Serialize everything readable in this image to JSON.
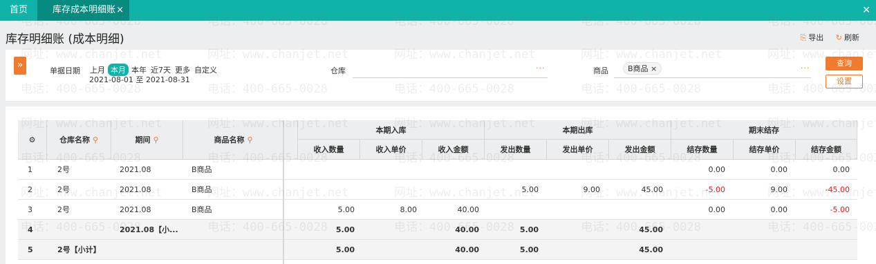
{
  "tabs": {
    "home": "首页",
    "active": "库存成本明细账",
    "active_close": "×",
    "window_close": "✕"
  },
  "header": {
    "title": "库存明细账 (成本明细)",
    "export_label": "导出",
    "refresh_label": "刷新",
    "export_icon": "export-icon",
    "refresh_icon": "refresh-icon"
  },
  "filter": {
    "expand_glyph": "»",
    "date_label": "单据日期",
    "periods": [
      "上月",
      "本月",
      "本年",
      "近7天",
      "更多",
      "自定义"
    ],
    "selected_period": "本月",
    "date_from": "2021-08-01",
    "date_sep": "至",
    "date_to": "2021-08-31",
    "warehouse_label": "仓库",
    "warehouse_value": "",
    "more_dots": "···",
    "product_label": "商品",
    "product_chip": "B商品",
    "chip_close": "×",
    "query_button": "查询",
    "settings_button": "设置"
  },
  "watermark": {
    "phone": "电话：400-665-0028",
    "site": "网址：www.chanjet.net"
  },
  "table": {
    "settings_icon": "gear-icon",
    "pin_glyph": "⚲",
    "headers": {
      "warehouse": "仓库名称",
      "period": "期间",
      "product": "商品名称",
      "group_in": "本期入库",
      "group_out": "本期出库",
      "group_end": "期末结存",
      "in_qty": "收入数量",
      "in_price": "收入单价",
      "in_amount": "收入金额",
      "out_qty": "发出数量",
      "out_price": "发出单价",
      "out_amount": "发出金额",
      "end_qty": "结存数量",
      "end_price": "结存单价",
      "end_amount": "结存金额"
    },
    "rows": [
      {
        "no": "1",
        "warehouse": "2号",
        "period": "2021.08",
        "product": "B商品",
        "in_qty": "",
        "in_price": "",
        "in_amount": "",
        "out_qty": "",
        "out_price": "",
        "out_amount": "",
        "end_qty": "0.00",
        "end_price": "0.00",
        "end_amount": "0.00"
      },
      {
        "no": "2",
        "warehouse": "2号",
        "period": "2021.08",
        "product": "B商品",
        "in_qty": "",
        "in_price": "",
        "in_amount": "",
        "out_qty": "5.00",
        "out_price": "9.00",
        "out_amount": "45.00",
        "end_qty": "-5.00",
        "end_price": "9.00",
        "end_amount": "-45.00"
      },
      {
        "no": "3",
        "warehouse": "2号",
        "period": "2021.08",
        "product": "B商品",
        "in_qty": "5.00",
        "in_price": "8.00",
        "in_amount": "40.00",
        "out_qty": "",
        "out_price": "",
        "out_amount": "",
        "end_qty": "0.00",
        "end_price": "0.00",
        "end_amount": "-5.00"
      },
      {
        "no": "4",
        "warehouse": "",
        "period": "2021.08【小...",
        "product": "",
        "in_qty": "5.00",
        "in_price": "",
        "in_amount": "40.00",
        "out_qty": "5.00",
        "out_price": "",
        "out_amount": "45.00",
        "end_qty": "",
        "end_price": "",
        "end_amount": ""
      },
      {
        "no": "5",
        "warehouse": "2号【小计】",
        "period": "",
        "product": "",
        "in_qty": "5.00",
        "in_price": "",
        "in_amount": "40.00",
        "out_qty": "5.00",
        "out_price": "",
        "out_amount": "45.00",
        "end_qty": "",
        "end_price": "",
        "end_amount": ""
      }
    ]
  }
}
